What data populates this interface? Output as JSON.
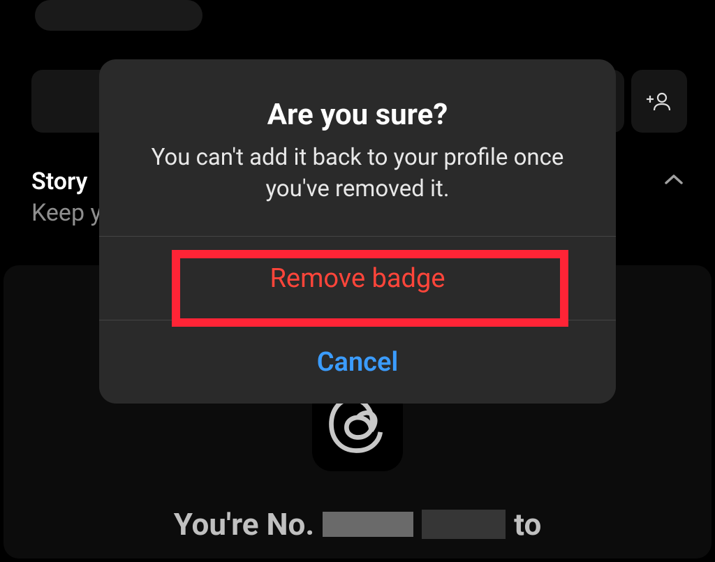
{
  "background": {
    "storyLabel": "Story",
    "keepLabel": "Keep y",
    "youreNumberPrefix": "You're No.",
    "youreNumberSuffix": "to"
  },
  "modal": {
    "title": "Are you sure?",
    "message": "You can't add it back to your profile once you've removed it.",
    "removeButton": "Remove badge",
    "cancelButton": "Cancel"
  }
}
